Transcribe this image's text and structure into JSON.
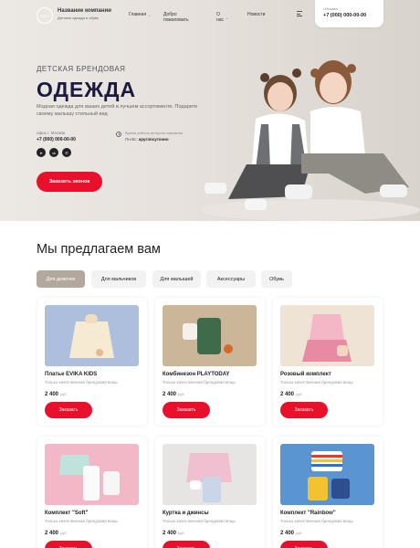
{
  "header": {
    "logo_text": "ЛОГО",
    "company_name": "Название компании",
    "company_tagline": "Детская одежда и обувь",
    "nav": [
      {
        "label": "Главная",
        "has_dropdown": true
      },
      {
        "label": "Добро пожаловать",
        "has_dropdown": false
      },
      {
        "label": "О нас",
        "has_dropdown": true
      },
      {
        "label": "Новости",
        "has_dropdown": false
      }
    ],
    "city": "г.Москва",
    "phone": "+7 (000) 000-00-00"
  },
  "hero": {
    "subtitle": "ДЕТСКАЯ БРЕНДОВАЯ",
    "title": "ОДЕЖДА",
    "description": "Модная одежда для ваших детей в лучшем ассортименте. Подарите своему малышу стильный вид",
    "office_label": "офис г. Москва",
    "office_phone": "+7 (000) 000-00-00",
    "hours_label": "Время работы интернет-магазина",
    "hours_prefix": "Пн-Вс:",
    "hours_value": "круглосуточно",
    "socials": [
      "telegram-icon",
      "vk-icon",
      "whatsapp-icon"
    ],
    "cta_label": "Заказать звонок"
  },
  "offer": {
    "title": "Мы предлагаем вам",
    "tabs": [
      {
        "label": "Для девочек",
        "active": true
      },
      {
        "label": "Для мальчиков",
        "active": false
      },
      {
        "label": "Для малышей",
        "active": false
      },
      {
        "label": "Аксессуары",
        "active": false
      },
      {
        "label": "Обувь",
        "active": false
      }
    ]
  },
  "products": [
    {
      "name": "Платье EVIKA KIDS",
      "desc": "Только качественная брендовая вещь",
      "price": "2 400",
      "currency": "руб",
      "button": "Заказать",
      "bg": "#aebfde"
    },
    {
      "name": "Комбинезон PLAYTODAY",
      "desc": "Только качественная брендовая вещь",
      "price": "2 400",
      "currency": "руб",
      "button": "Заказать",
      "bg": "#cbb69a"
    },
    {
      "name": "Розовый комплект",
      "desc": "Только качественная брендовая вещь",
      "price": "2 400",
      "currency": "руб",
      "button": "Заказать",
      "bg": "#efe3d6"
    },
    {
      "name": "Комплект \"Soft\"",
      "desc": "Только качественная брендовая вещь",
      "price": "2 400",
      "currency": "руб",
      "button": "Заказать",
      "bg": "#f3b8c8"
    },
    {
      "name": "Куртка и джинсы",
      "desc": "Только качественная брендовая вещь",
      "price": "2 400",
      "currency": "руб",
      "button": "Заказать",
      "bg": "#e7e5e3"
    },
    {
      "name": "Комплект \"Rainbow\"",
      "desc": "Только качественная брендовая вещь",
      "price": "2 400",
      "currency": "руб",
      "button": "Заказать",
      "bg": "#5a94d1"
    }
  ],
  "colors": {
    "accent": "#e8102a",
    "title_dark": "#1d1a3f",
    "tab_active": "#b3a89c"
  }
}
